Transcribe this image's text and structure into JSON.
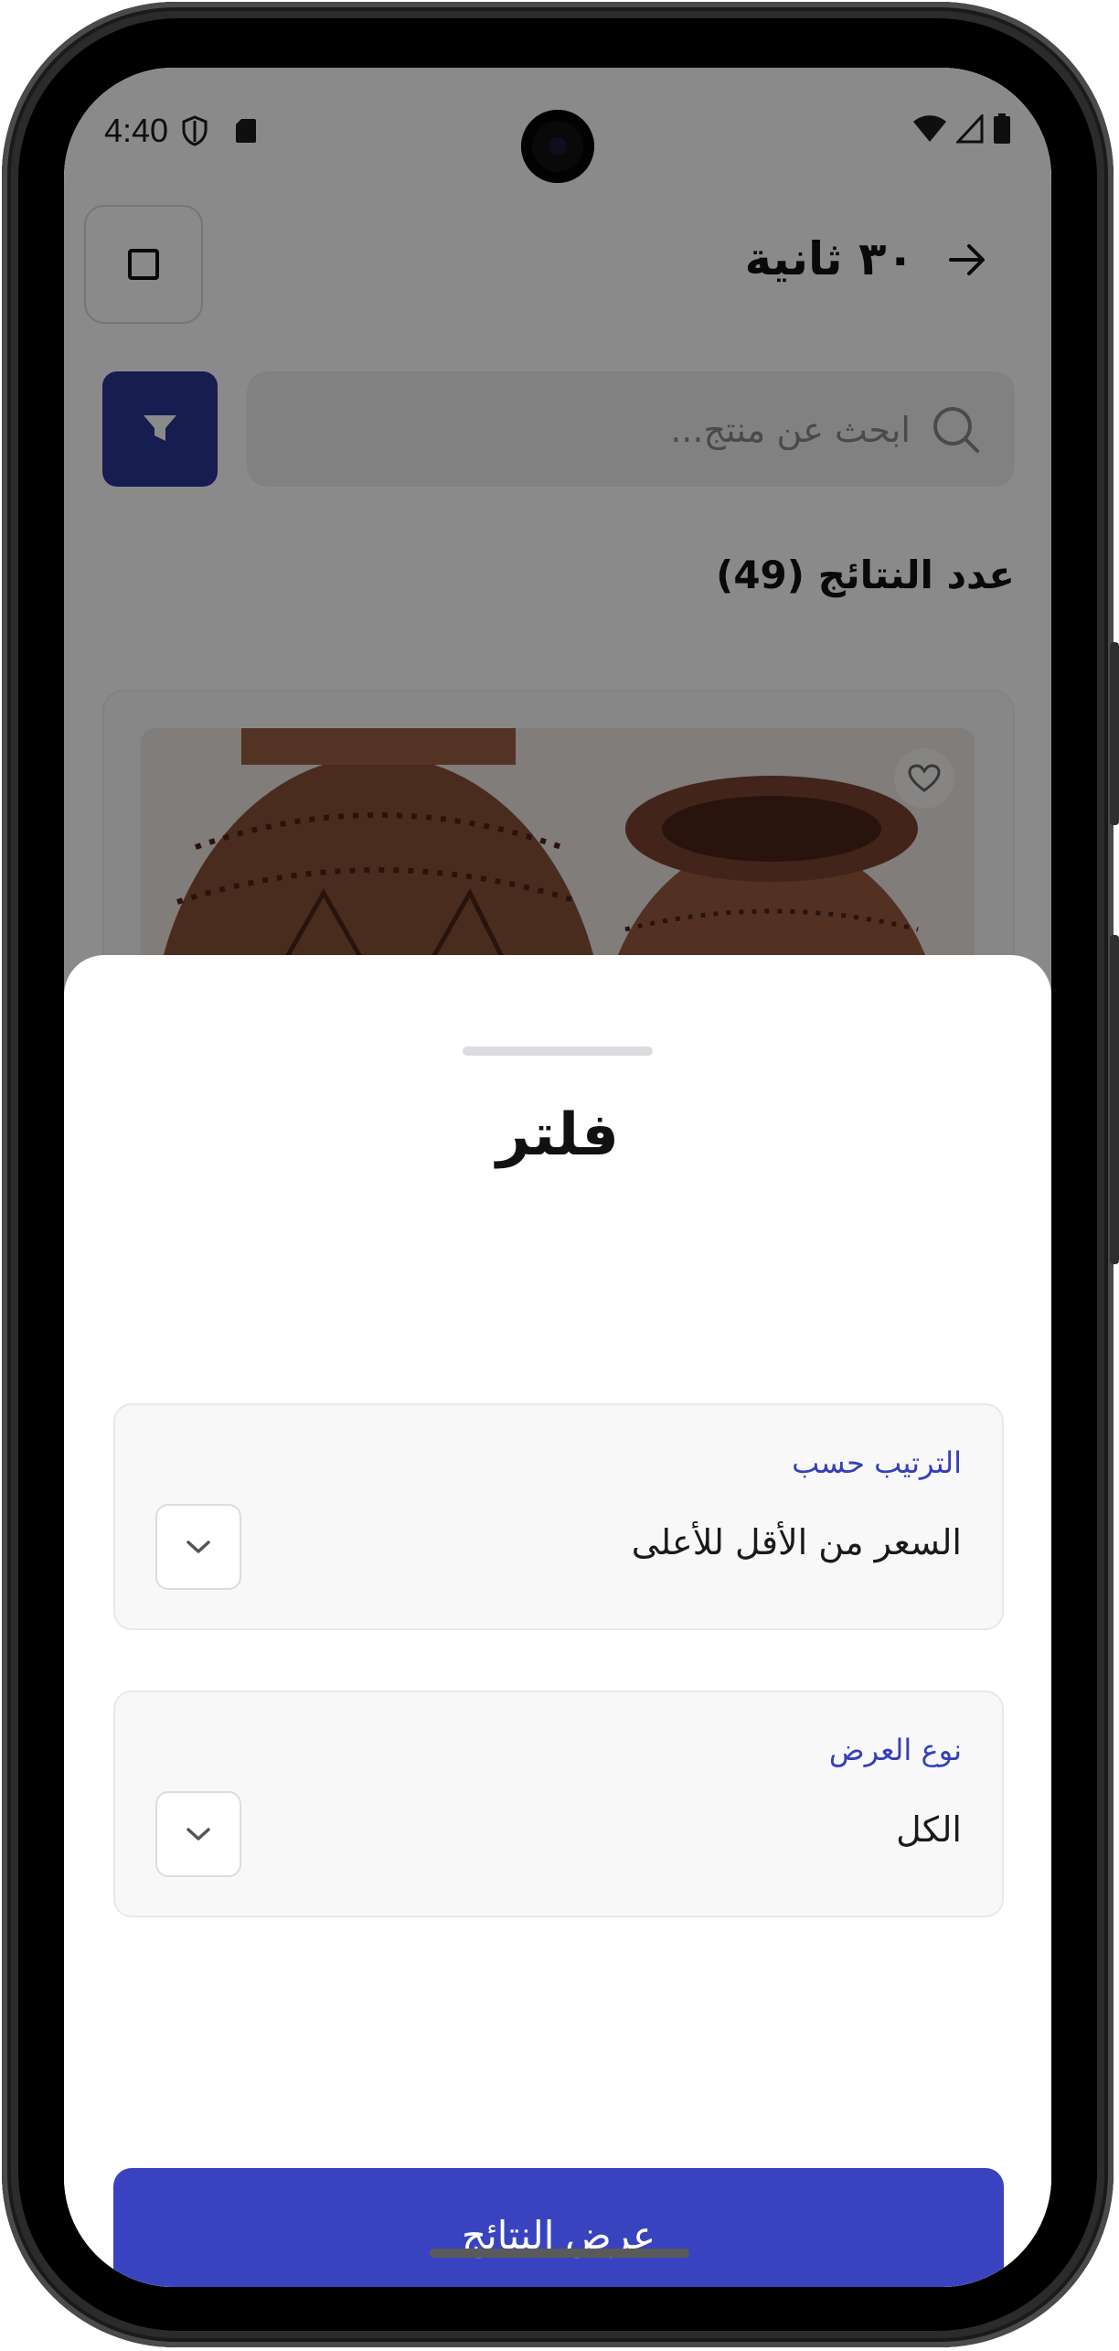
{
  "status_bar": {
    "time": "4:40",
    "icons": [
      "shield-icon",
      "sd-card-icon",
      "wifi-icon",
      "signal-icon",
      "battery-icon"
    ]
  },
  "header": {
    "title": "٣٠ ثانية",
    "icons": {
      "back": "arrow-right-icon",
      "square": "stop-square-icon"
    }
  },
  "search": {
    "placeholder": "ابحث عن منتج...",
    "value": "",
    "icons": {
      "search": "search-icon",
      "filter": "funnel-icon"
    }
  },
  "results": {
    "count_label": "عدد النتائج (49)"
  },
  "product": {
    "image": "clay-pots",
    "favorite_icon": "heart-icon"
  },
  "filter_sheet": {
    "title": "فلتر",
    "sort": {
      "label": "الترتيب حسب",
      "value": "السعر من الأقل للأعلى"
    },
    "display_type": {
      "label": "نوع العرض",
      "value": "الكل"
    },
    "submit_label": "عرض النتائج"
  },
  "colors": {
    "primary": "#3a43bf",
    "primary_dark": "#2c3597",
    "label_accent": "#3540b8",
    "overlay": "rgba(0,0,0,0.46)"
  }
}
